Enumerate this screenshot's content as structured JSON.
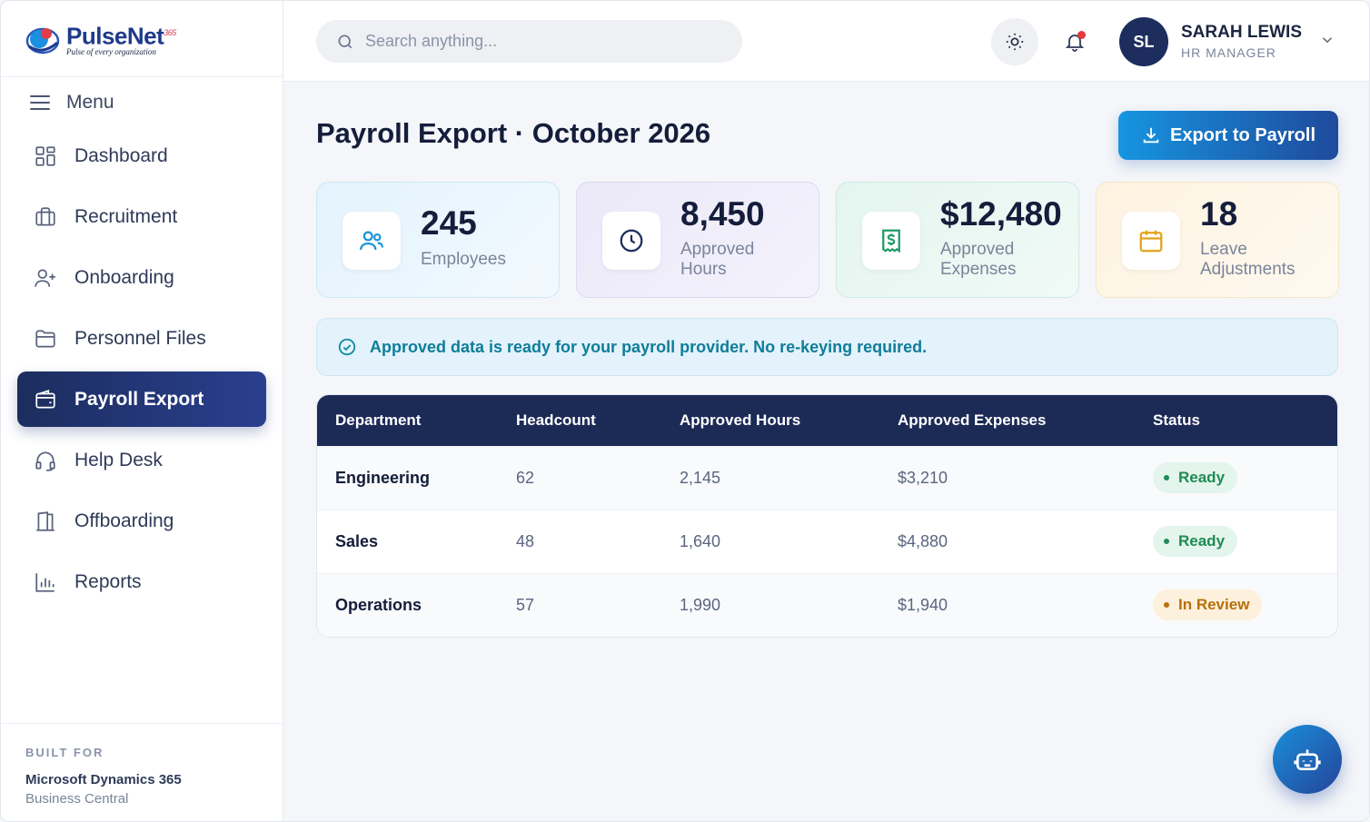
{
  "brand": {
    "name": "PulseNet",
    "suffix": "365",
    "tagline": "Pulse of every organization"
  },
  "menu": {
    "label": "Menu"
  },
  "sidebar": {
    "items": [
      {
        "label": "Dashboard",
        "icon": "dashboard-icon"
      },
      {
        "label": "Recruitment",
        "icon": "briefcase-icon"
      },
      {
        "label": "Onboarding",
        "icon": "user-plus-icon"
      },
      {
        "label": "Personnel Files",
        "icon": "folder-icon"
      },
      {
        "label": "Payroll Export",
        "icon": "wallet-icon",
        "active": true
      },
      {
        "label": "Help Desk",
        "icon": "headset-icon"
      },
      {
        "label": "Offboarding",
        "icon": "door-exit-icon"
      },
      {
        "label": "Reports",
        "icon": "bar-chart-icon"
      }
    ]
  },
  "built_for": {
    "label": "BUILT FOR",
    "name": "Microsoft Dynamics 365",
    "sub": "Business Central"
  },
  "search": {
    "placeholder": "Search anything..."
  },
  "user": {
    "initials": "SL",
    "name": "SARAH LEWIS",
    "role": "HR MANAGER"
  },
  "page": {
    "title": "Payroll Export · October 2026",
    "export_label": "Export to Payroll"
  },
  "stats": [
    {
      "value": "245",
      "label": "Employees",
      "icon": "users-icon"
    },
    {
      "value": "8,450",
      "label_line1": "Approved",
      "label_line2": "Hours",
      "icon": "clock-icon"
    },
    {
      "value": "$12,480",
      "label_line1": "Approved",
      "label_line2": "Expenses",
      "icon": "receipt-dollar-icon"
    },
    {
      "value": "18",
      "label_line1": "Leave",
      "label_line2": "Adjustments",
      "icon": "calendar-icon"
    }
  ],
  "notice": {
    "text": "Approved data is ready for your payroll provider. No re-keying required."
  },
  "table": {
    "headers": [
      "Department",
      "Headcount",
      "Approved Hours",
      "Approved Expenses",
      "Status"
    ],
    "rows": [
      {
        "department": "Engineering",
        "headcount": "62",
        "hours": "2,145",
        "expenses": "$3,210",
        "status": "Ready"
      },
      {
        "department": "Sales",
        "headcount": "48",
        "hours": "1,640",
        "expenses": "$4,880",
        "status": "Ready"
      },
      {
        "department": "Operations",
        "headcount": "57",
        "hours": "1,990",
        "expenses": "$1,940",
        "status": "In Review"
      }
    ]
  },
  "colors": {
    "primary_navy": "#1c2d5e",
    "accent_blue": "#1695e0",
    "ready_green": "#1f8a55",
    "review_amber": "#b8700a"
  }
}
